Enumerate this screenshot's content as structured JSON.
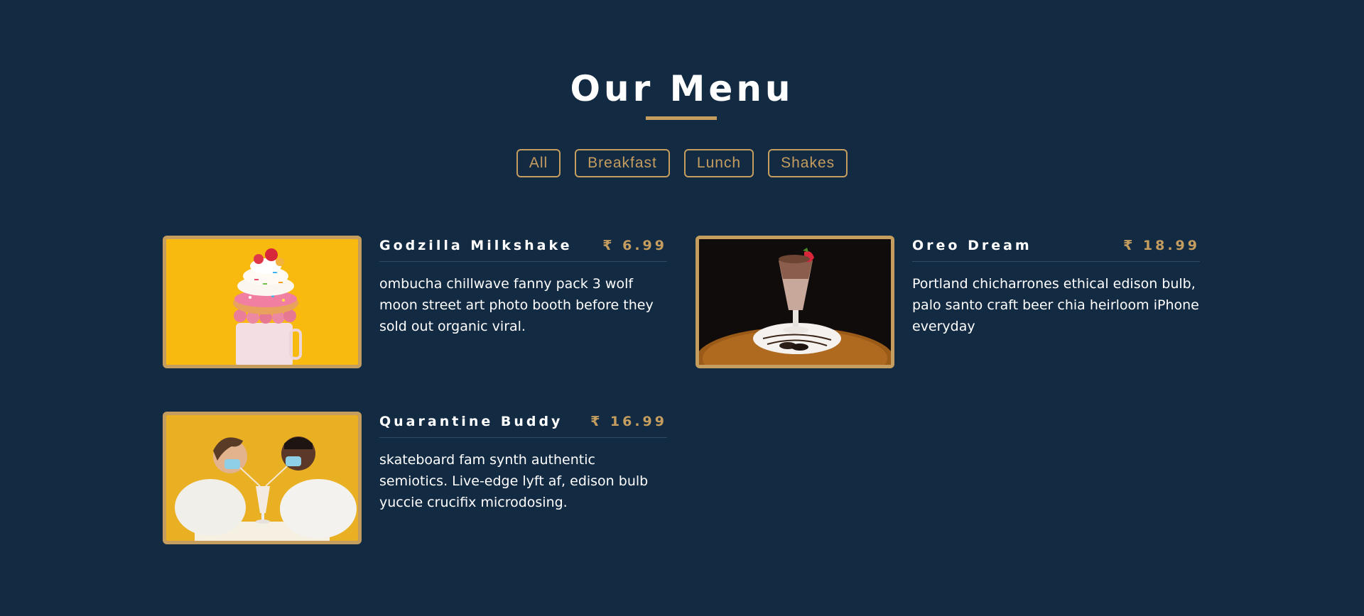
{
  "header": {
    "title": "Our Menu"
  },
  "filters": [
    "All",
    "Breakfast",
    "Lunch",
    "Shakes"
  ],
  "colors": {
    "background": "#132a43",
    "accent": "#c59d5f",
    "text": "#ffffff"
  },
  "menu": [
    {
      "name": "Godzilla Milkshake",
      "price": "₹ 6.99",
      "description": "ombucha chillwave fanny pack 3 wolf moon street art photo booth before they sold out organic viral.",
      "image": "milkshake-donut-photo"
    },
    {
      "name": "Oreo Dream",
      "price": "₹ 18.99",
      "description": "Portland chicharrones ethical edison bulb, palo santo craft beer chia heirloom iPhone everyday",
      "image": "oreo-shake-photo"
    },
    {
      "name": "Quarantine Buddy",
      "price": "₹ 16.99",
      "description": "skateboard fam synth authentic semiotics. Live-edge lyft af, edison bulb yuccie crucifix microdosing.",
      "image": "couple-sharing-shake-photo"
    }
  ]
}
